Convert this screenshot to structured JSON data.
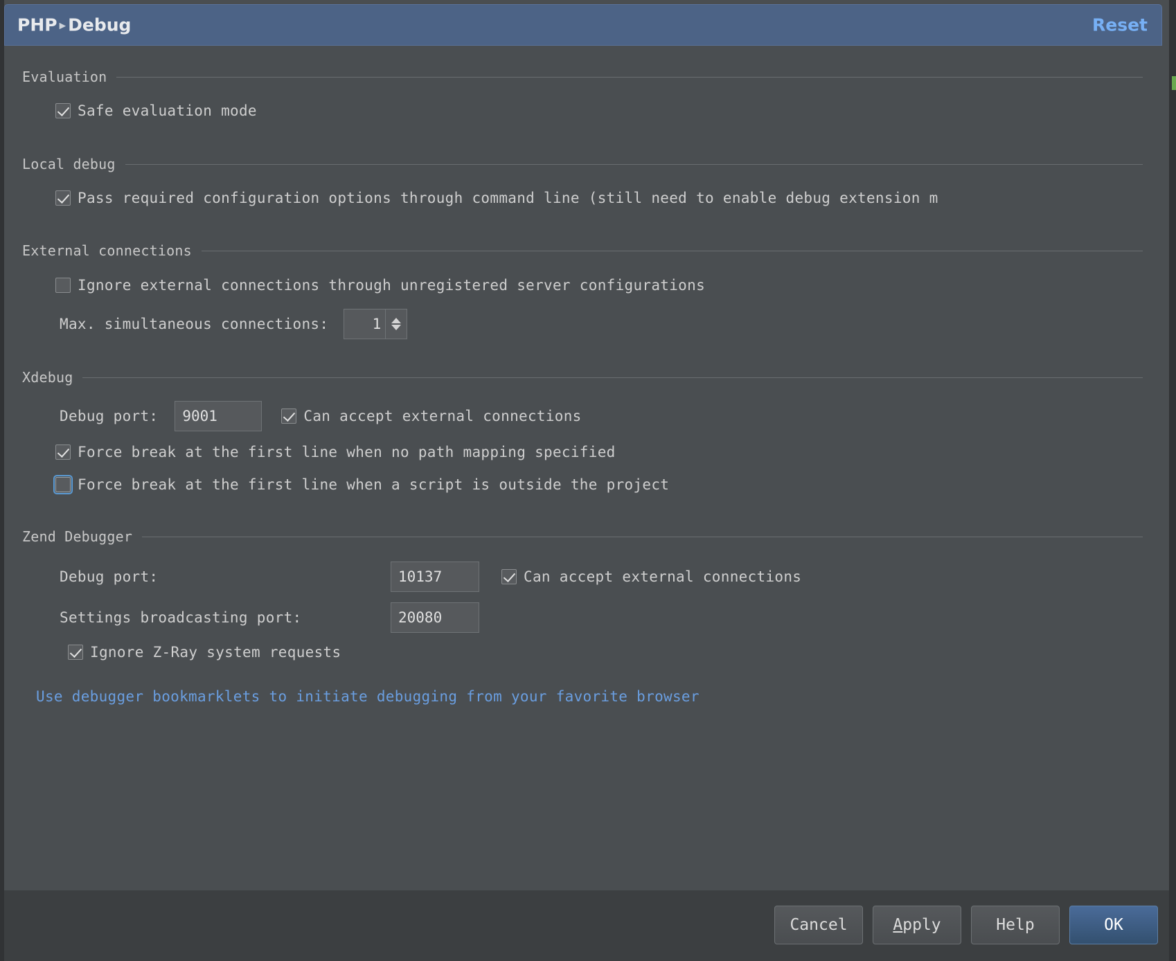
{
  "header": {
    "breadcrumb_root": "PHP",
    "breadcrumb_sep": "▸",
    "breadcrumb_leaf": "Debug",
    "reset_label": "Reset",
    "accent_color": "#4c6386",
    "link_color": "#77b0f5"
  },
  "sections": {
    "evaluation": {
      "title": "Evaluation",
      "safe_evaluation_mode": "Safe evaluation mode"
    },
    "local_debug": {
      "title": "Local debug",
      "pass_required_options": "Pass required configuration options through command line (still need to enable debug extension m"
    },
    "external_connections": {
      "title": "External connections",
      "ignore_external": "Ignore external connections through unregistered server configurations",
      "max_connections_label": "Max. simultaneous connections:",
      "max_connections_value": "1"
    },
    "xdebug": {
      "title": "Xdebug",
      "debug_port_label": "Debug port:",
      "debug_port_value": "9001",
      "can_accept_external": "Can accept external connections",
      "force_break_no_path_mapping": "Force break at the first line when no path mapping specified",
      "force_break_outside_project": "Force break at the first line when a script is outside the project"
    },
    "zend_debugger": {
      "title": "Zend Debugger",
      "debug_port_label": "Debug port:",
      "debug_port_value": "10137",
      "can_accept_external": "Can accept external connections",
      "broadcast_port_label": "Settings broadcasting port:",
      "broadcast_port_value": "20080",
      "ignore_zray": "Ignore Z-Ray system requests"
    },
    "bookmarklets_link": "Use debugger bookmarklets to initiate debugging from your favorite browser"
  },
  "footer": {
    "cancel": "Cancel",
    "apply_prefix": "A",
    "apply_rest": "pply",
    "help": "Help",
    "ok": "OK"
  }
}
